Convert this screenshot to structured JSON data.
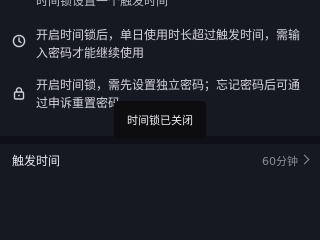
{
  "colors": {
    "background": "#161822",
    "toast": "#0d0d10",
    "muted": "#8a8c99"
  },
  "top_partial_text": "时间锁设置一个触发时间",
  "info_items": [
    {
      "icon": "clock-icon",
      "text": "开启时间锁后，单日使用时长超过触发时间，需输入密码才能继续使用"
    },
    {
      "icon": "lock-icon",
      "text": "开启时间锁，需先设置独立密码；忘记密码后可通过申诉重置密码"
    }
  ],
  "settings": {
    "trigger_time": {
      "label": "触发时间",
      "value": "60分钟"
    }
  },
  "toast": {
    "text": "时间锁已关闭"
  }
}
